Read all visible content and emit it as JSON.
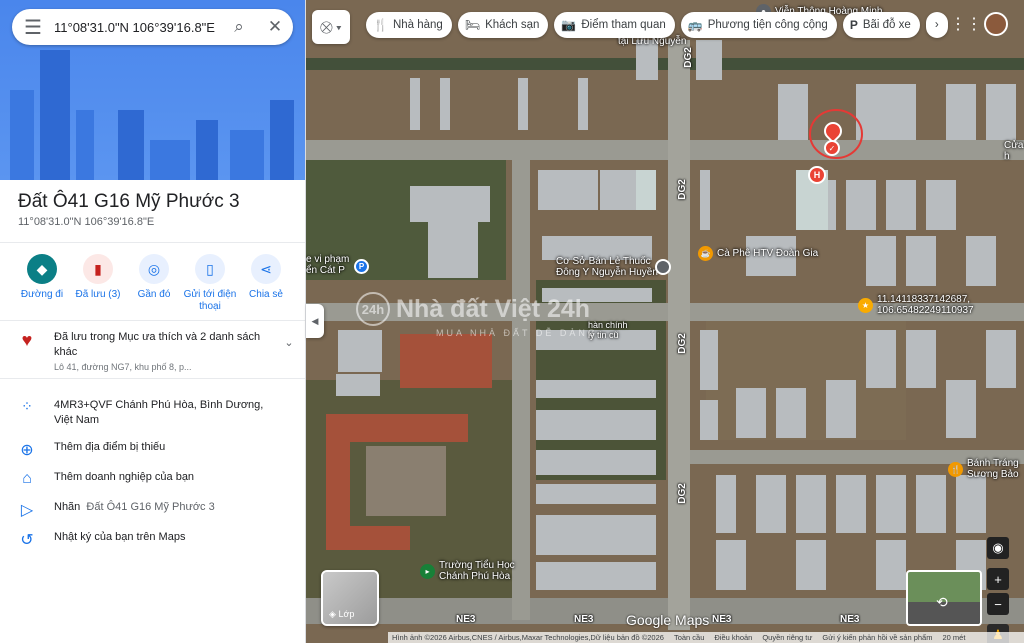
{
  "search": {
    "query": "11°08'31.0\"N 106°39'16.8\"E"
  },
  "place": {
    "title": "Đất Ô41 G16 Mỹ Phước 3",
    "coords": "11°08'31.0\"N 106°39'16.8\"E"
  },
  "actions": [
    {
      "label": "Đường đi",
      "icon": "directions-icon"
    },
    {
      "label": "Đã lưu (3)",
      "icon": "bookmark-icon"
    },
    {
      "label": "Gần đó",
      "icon": "nearby-icon"
    },
    {
      "label": "Gửi tới điện thoại",
      "icon": "phone-icon"
    },
    {
      "label": "Chia sẻ",
      "icon": "share-icon"
    }
  ],
  "saved": {
    "text": "Đã lưu trong Mục ưa thích và 2 danh sách khác",
    "sub": "Lô 41, đường NG7, khu phố 8, p..."
  },
  "details": {
    "plus_code": "4MR3+QVF Chánh Phú Hòa, Bình Dương, Việt Nam",
    "add_missing": "Thêm địa điểm bị thiếu",
    "add_business": "Thêm doanh nghiệp của bạn",
    "label_key": "Nhãn",
    "label_value": "Đất Ô41 G16 Mỹ Phước 3",
    "timeline": "Nhật ký của bạn trên Maps"
  },
  "chips": [
    "Nhà hàng",
    "Khách sạn",
    "Điểm tham quan",
    "Phương tiện công cộng",
    "Bãi đỗ xe"
  ],
  "map_labels": {
    "poi_top": "Viễn Thông Hoàng Minh",
    "poi_top2": "tại Lưu Nguyễn",
    "poi_clinic1": "Cơ Sở Bán Lẻ Thuốc",
    "poi_clinic2": "Đông Y Nguyễn Huyền",
    "poi_cafe": "Cà Phê HTV Đoàn Gia",
    "poi_coord1": "11.14118337142687,",
    "poi_coord2": "106.65482249110937",
    "poi_bakery1": "Bánh Tráng",
    "poi_bakery2": "Sương Bảo",
    "poi_school1": "Trường Tiểu Học",
    "poi_school2": "Chánh Phú Hòa",
    "poi_left1": "e vi phạm",
    "poi_left2": "ển Cát P",
    "poi_right": "Cửa h",
    "poi_center1": "hàn chính",
    "poi_center2": "lý tin cũ",
    "road_dg2": "DG2",
    "road_ne3": "NE3"
  },
  "watermark": {
    "main": "Nhà đất Việt 24h",
    "sub": "MUA NHÀ ĐẤT DỄ DÀNG",
    "badge": "24h"
  },
  "layers_label": "Lớp",
  "brand": "Google Maps",
  "footer": [
    "Hình ảnh ©2026 Airbus,CNES / Airbus,Maxar Technologies,Dữ liệu bản đồ ©2026",
    "Toàn cầu",
    "Điều khoản",
    "Quyền riêng tư",
    "Gửi ý kiến phản hồi về sản phẩm",
    "20 mét"
  ],
  "colors": {
    "accent": "#1a73e8",
    "pin": "#ea4335",
    "teal": "#0b7f86"
  }
}
